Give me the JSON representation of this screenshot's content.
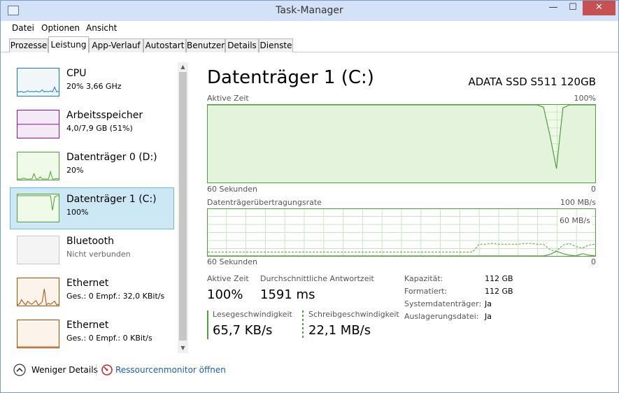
{
  "window": {
    "title": "Task-Manager",
    "min_glyph": "—",
    "max_glyph": "☐",
    "close_glyph": "✕"
  },
  "menu": [
    "Datei",
    "Optionen",
    "Ansicht"
  ],
  "tabs": [
    "Prozesse",
    "Leistung",
    "App-Verlauf",
    "Autostart",
    "Benutzer",
    "Details",
    "Dienste"
  ],
  "active_tab": "Leistung",
  "sidebar": {
    "items": [
      {
        "name": "CPU",
        "sub": "20% 3,66 GHz",
        "color": "#117dbb",
        "fill": "#f1f6fa"
      },
      {
        "name": "Arbeitsspeicher",
        "sub": "4,0/7,9 GB (51%)",
        "color": "#8b12ae",
        "fill": "#f4eaf7"
      },
      {
        "name": "Datenträger 0 (D:)",
        "sub": "20%",
        "color": "#4da03a",
        "fill": "#effae9"
      },
      {
        "name": "Datenträger 1 (C:)",
        "sub": "100%",
        "color": "#4da03a",
        "fill": "#effae9",
        "selected": true
      },
      {
        "name": "Bluetooth",
        "sub": "Nicht verbunden",
        "color": "#c8c8c8",
        "fill": "#f4f4f4"
      },
      {
        "name": "Ethernet",
        "sub": "Ges.: 0 Empf.: 32,0 KBit/s",
        "color": "#a74f01",
        "fill": "#fcf3eb"
      },
      {
        "name": "Ethernet",
        "sub": "Ges.: 0 Empf.: 0 KBit/s",
        "color": "#a74f01",
        "fill": "#fcf3eb"
      }
    ]
  },
  "detail": {
    "title": "Datenträger 1 (C:)",
    "model": "ADATA SSD S511 120GB",
    "chart1": {
      "label": "Aktive Zeit",
      "max_label": "100%",
      "time_label": "60 Sekunden",
      "zero_label": "0"
    },
    "chart2": {
      "label": "Datenträgerübertragungsrate",
      "max_label": "100 MB/s",
      "mid_label": "60 MB/s",
      "time_label": "60 Sekunden",
      "zero_label": "0"
    },
    "stats": {
      "active_label": "Aktive Zeit",
      "active_value": "100%",
      "response_label": "Durchschnittliche Antwortzeit",
      "response_value": "1591 ms",
      "read_label": "Lesegeschwindigkeit",
      "read_value": "65,7 KB/s",
      "write_label": "Schreibgeschwindigkeit",
      "write_value": "22,1 MB/s"
    },
    "properties": [
      {
        "label": "Kapazität:",
        "value": "112 GB"
      },
      {
        "label": "Formatiert:",
        "value": "112 GB"
      },
      {
        "label": "Systemdatenträger:",
        "value": "Ja"
      },
      {
        "label": "Auslagerungsdatei:",
        "value": "Ja"
      }
    ]
  },
  "footer": {
    "fewer_details": "Weniger Details",
    "resource_monitor": "Ressourcenmonitor öffnen"
  },
  "colors": {
    "disk": "#4da03a",
    "disk_fill": "#effae9",
    "grid": "#c8e6c0",
    "selection": "#cce8f4",
    "link": "#1b5fae"
  },
  "icons": [
    "taskmanager-icon",
    "chevron-up-icon",
    "resource-monitor-icon",
    "scroll-up-arrow-icon",
    "scroll-down-arrow-icon"
  ],
  "chart_data": {
    "active_time": {
      "unit": "%",
      "ylim": [
        0,
        100
      ],
      "xlim_seconds": [
        60,
        0
      ],
      "values": [
        100,
        100,
        100,
        100,
        100,
        100,
        100,
        100,
        100,
        100,
        100,
        100,
        100,
        100,
        100,
        100,
        100,
        100,
        100,
        100,
        100,
        100,
        100,
        100,
        100,
        100,
        100,
        100,
        100,
        100,
        100,
        100,
        100,
        100,
        100,
        100,
        100,
        100,
        100,
        100,
        100,
        100,
        100,
        100,
        100,
        100,
        100,
        100,
        100,
        100,
        100,
        100,
        97,
        60,
        18,
        96,
        100,
        100,
        100,
        100,
        100
      ]
    },
    "transfer_rate": {
      "unit": "MB/s",
      "ylim": [
        0,
        100
      ],
      "xlim_seconds": [
        60,
        0
      ],
      "read": [
        0,
        0,
        0,
        0,
        0,
        0,
        0,
        0,
        0,
        0,
        0,
        0,
        0,
        0,
        0,
        0,
        0,
        0,
        0,
        0,
        0,
        0,
        0,
        0,
        0,
        0,
        0,
        0,
        0,
        0,
        0,
        0,
        0,
        0,
        0,
        0,
        0,
        0,
        0,
        0,
        0,
        0,
        0,
        0,
        0,
        0,
        0,
        0,
        0,
        0,
        0,
        0,
        0,
        2,
        6,
        3,
        1,
        0,
        3,
        1,
        0
      ],
      "write": [
        5,
        5,
        5,
        5,
        5,
        5,
        5,
        5,
        5,
        5,
        5,
        5,
        5,
        5,
        5,
        5,
        5,
        5,
        5,
        5,
        5,
        5,
        5,
        5,
        5,
        5,
        5,
        5,
        5,
        5,
        5,
        5,
        5,
        5,
        5,
        5,
        5,
        5,
        5,
        5,
        5,
        5,
        15,
        15,
        16,
        15,
        15,
        15,
        15,
        16,
        16,
        15,
        15,
        8,
        6,
        14,
        16,
        12,
        10,
        14,
        15
      ]
    }
  }
}
